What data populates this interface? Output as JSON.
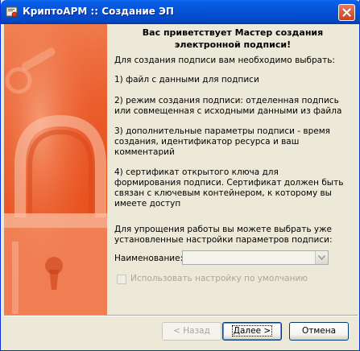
{
  "window": {
    "title": "КриптоАРМ :: Создание ЭП"
  },
  "content": {
    "heading": "Вас приветствует Мастер создания\nэлектронной подписи!",
    "intro": "Для создания подписи вам необходимо выбрать:",
    "step1": "1) файл с данными для подписи",
    "step2": "2) режим создания подписи: отделенная подпись\nили совмещенная с исходными данными из файла",
    "step3": "3) дополнительные параметры подписи - время\nсоздания, идентификатор ресурса и ваш\nкомментарий",
    "step4": "4) сертификат открытого ключа для\nформирования подписи. Сертификат должен быть\nсвязан с ключевым контейнером, к которому вы\nимеете доступ",
    "settings_hint": "Для упрощения работы вы можете выбрать уже\nустановленные настройки параметров подписи:",
    "name_label": "Наименование:",
    "name_value": "",
    "default_checkbox_label": "Использовать настройку по умолчанию",
    "default_checked": false
  },
  "buttons": {
    "back": "< Назад",
    "next": "Далее >",
    "cancel": "Отмена"
  },
  "icons": {
    "title_icon": "app-certificate-icon",
    "close": "close-icon",
    "banner": "padlock-banner-image",
    "combo_arrow": "chevron-down-icon"
  },
  "colors": {
    "titlebar": "#0454d8",
    "banner": "#e8521f",
    "dialog_bg": "#ece9d8"
  }
}
